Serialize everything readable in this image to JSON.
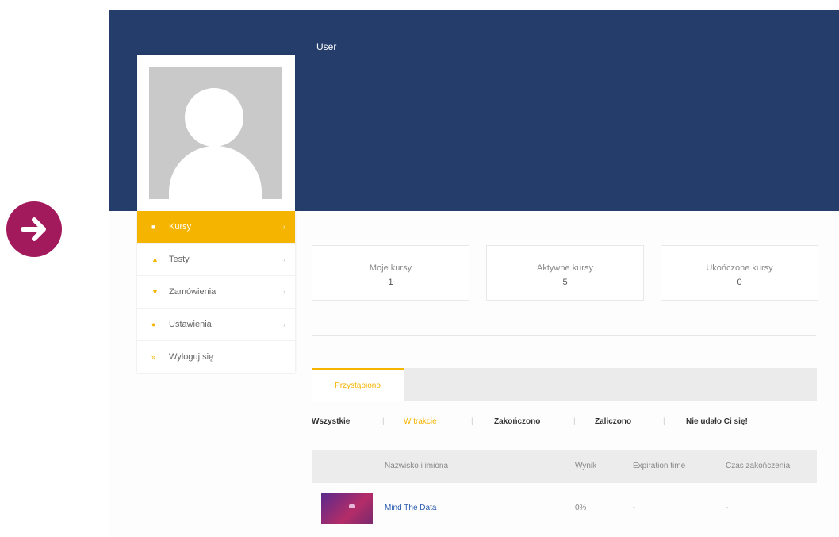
{
  "banner": {
    "user_label": "User"
  },
  "sidebar": {
    "items": [
      {
        "label": "Kursy",
        "icon": "course-icon",
        "active": true
      },
      {
        "label": "Testy",
        "icon": "test-icon",
        "active": false
      },
      {
        "label": "Zamówienia",
        "icon": "cart-icon",
        "active": false
      },
      {
        "label": "Ustawienia",
        "icon": "settings-icon",
        "active": false
      },
      {
        "label": "Wyloguj się",
        "icon": "logout-icon",
        "active": false
      }
    ]
  },
  "stats": [
    {
      "label": "Moje kursy",
      "value": "1"
    },
    {
      "label": "Aktywne kursy",
      "value": "5"
    },
    {
      "label": "Ukończone kursy",
      "value": "0"
    }
  ],
  "tabs": [
    {
      "label": "Przystąpiono"
    }
  ],
  "filters": [
    "Wszystkie",
    "W trakcie",
    "Zakończono",
    "Zaliczono",
    "Nie udało Ci się!"
  ],
  "table": {
    "columns": [
      "Nazwisko i imiona",
      "Wynik",
      "Expiration time",
      "Czas zakończenia"
    ],
    "rows": [
      {
        "course": "Mind The Data",
        "score": "0%",
        "expiration": "-",
        "completed": "-"
      }
    ]
  },
  "colors": {
    "banner": "#243d6b",
    "accent": "#f5b400",
    "arrow": "#a31a5c",
    "link": "#2a5db0"
  }
}
